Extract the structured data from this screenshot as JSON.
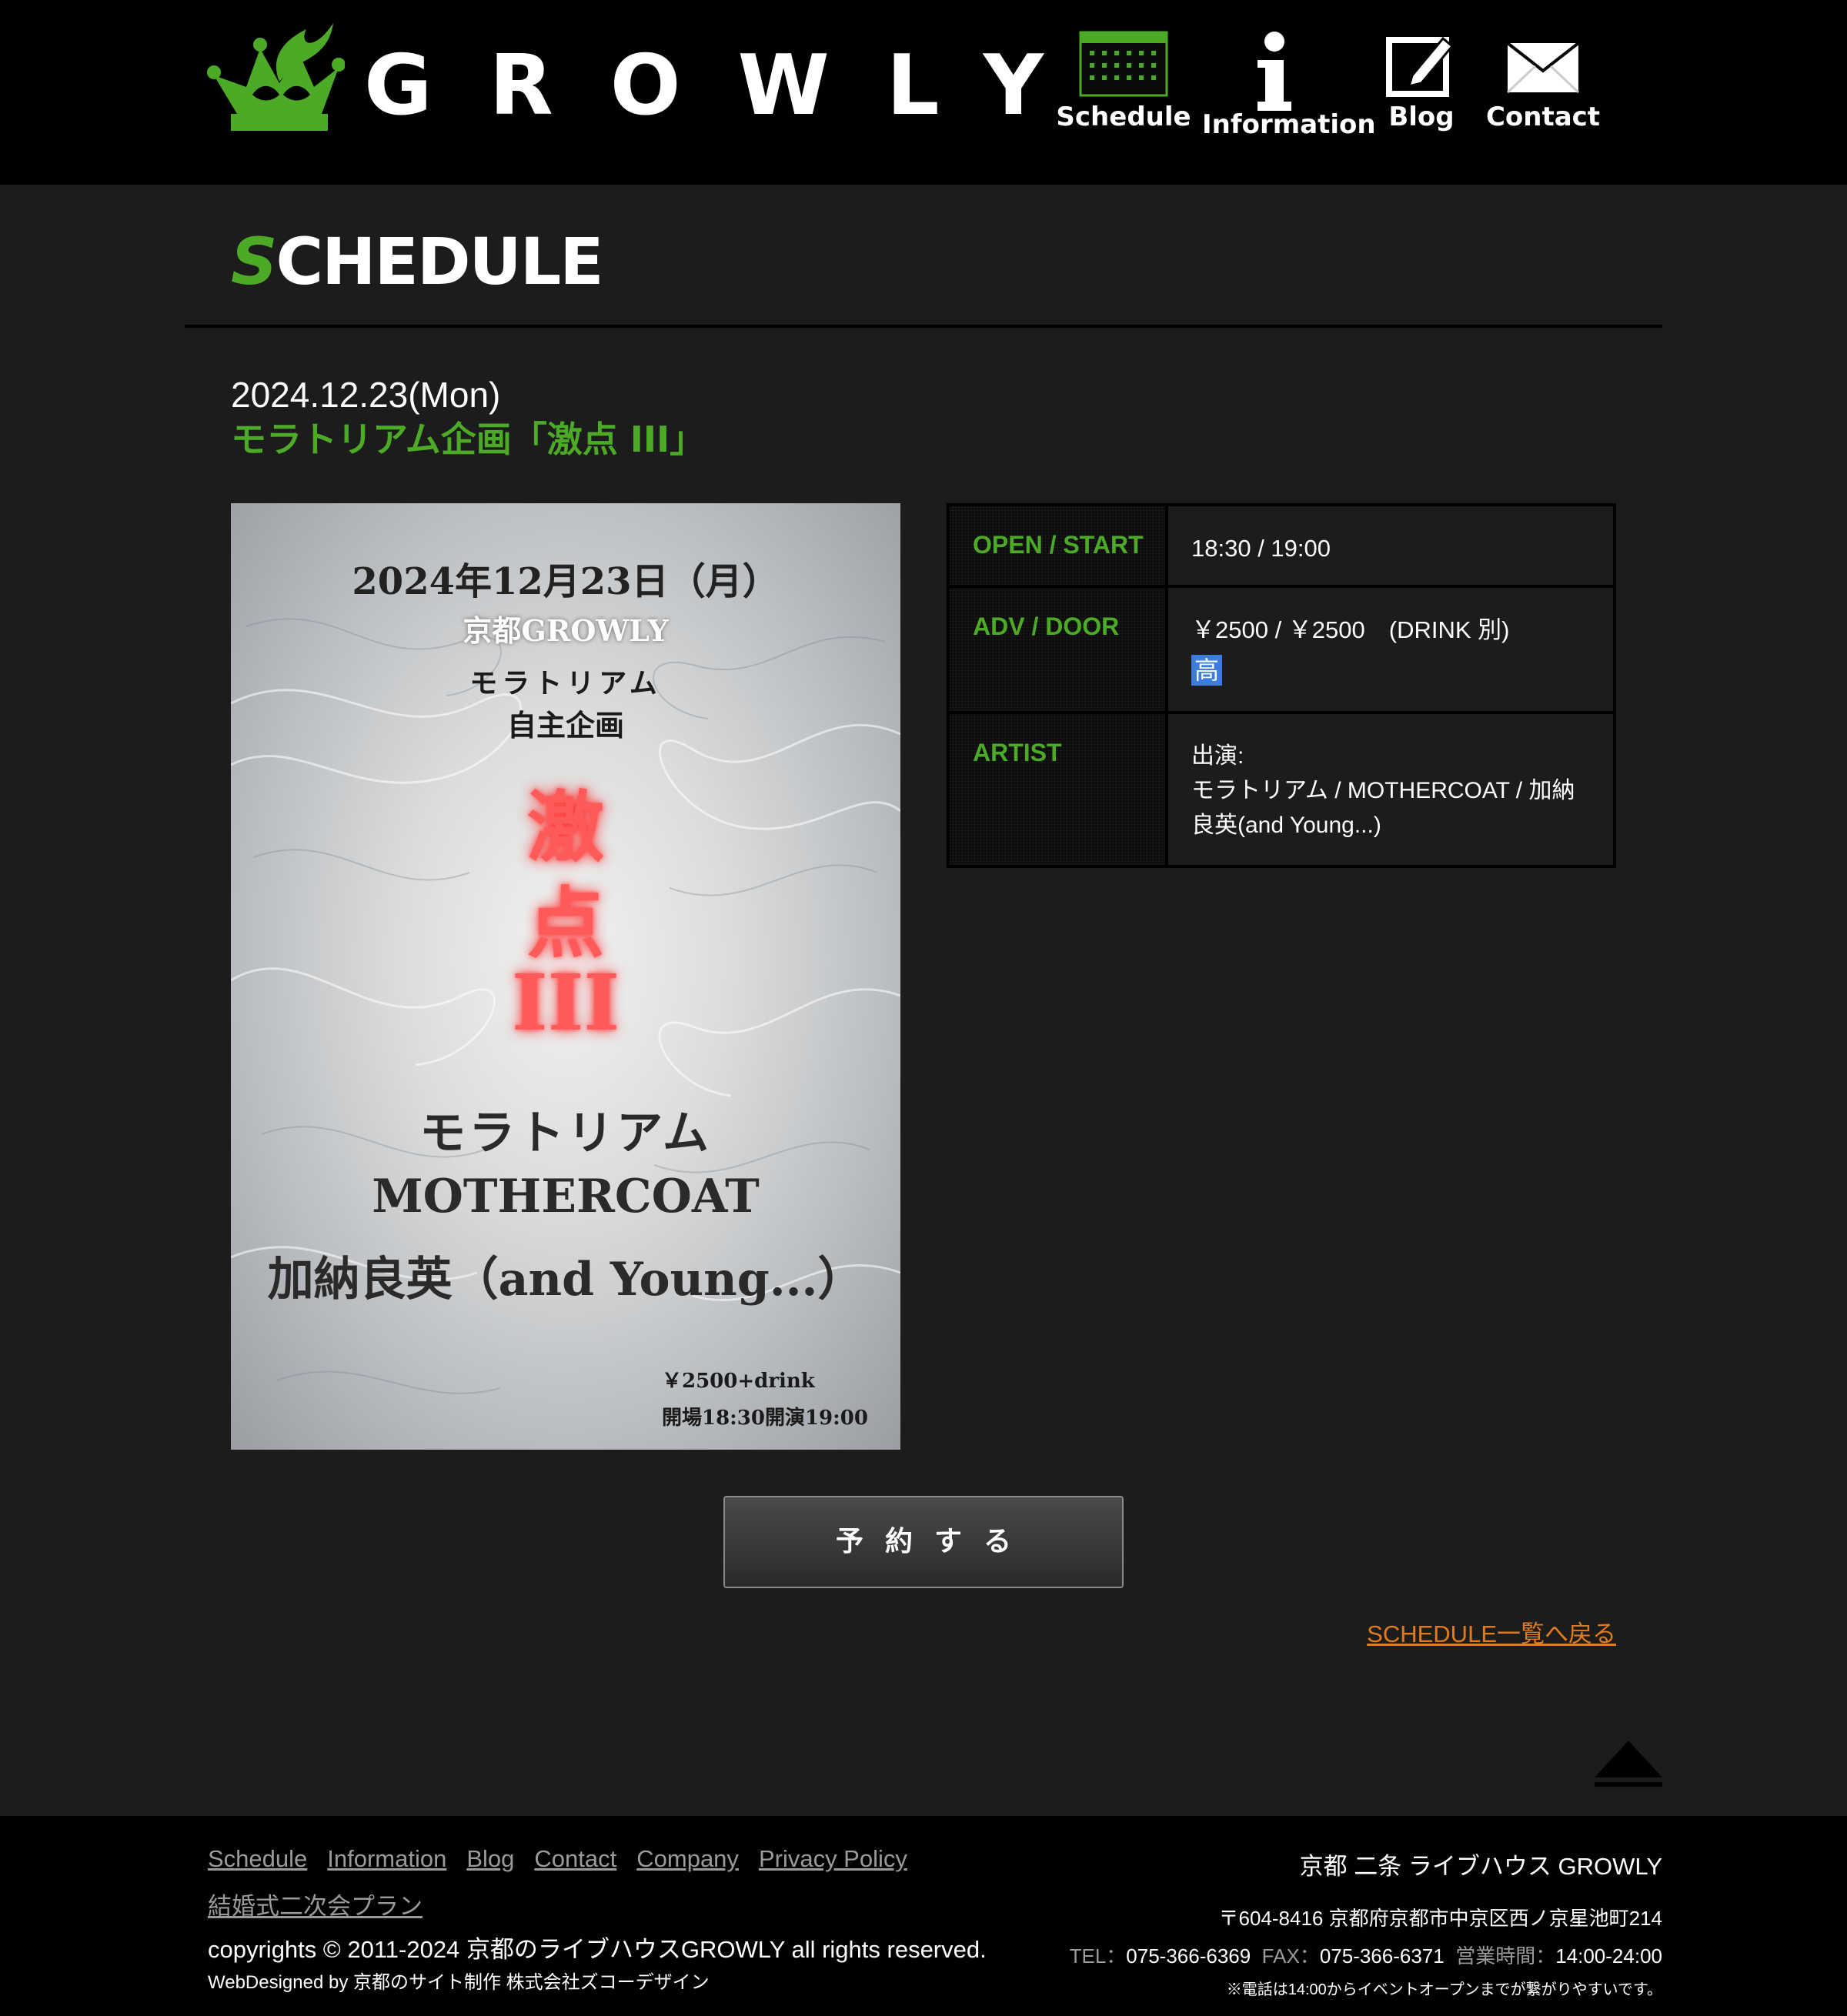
{
  "header": {
    "logo_text": "GROWLY",
    "nav": [
      {
        "label": "Schedule",
        "icon": "calendar-icon"
      },
      {
        "label": "Information",
        "icon": "info-icon"
      },
      {
        "label": "Blog",
        "icon": "pencil-note-icon"
      },
      {
        "label": "Contact",
        "icon": "envelope-icon"
      }
    ]
  },
  "page": {
    "heading": "SCHEDULE",
    "heading_first": "S",
    "heading_rest": "CHEDULE"
  },
  "event": {
    "date": "2024.12.23(Mon)",
    "title": "モラトリアム企画「激点 III」",
    "flyer": {
      "date": "2024年12月23日（月）",
      "venue": "京都GROWLY",
      "org_line1": "モラトリアム",
      "org_line2": "自主企画",
      "big1": "激",
      "big2": "点",
      "big3": "III",
      "artist1": "モラトリアム",
      "artist2": "MOTHERCOAT",
      "artist3": "加納良英（and Young...）",
      "price": "￥2500+drink",
      "time": "開場18:30開演19:00"
    },
    "info": {
      "open_label": "OPEN / START",
      "open_value": "18:30 / 19:00",
      "adv_label": "ADV / DOOR",
      "adv_value": "￥2500 / ￥2500　(DRINK 別)",
      "adv_badge": "高",
      "artist_label": "ARTIST",
      "artist_prefix": "出演:",
      "artist_line1": "モラトリアム / MOTHERCOAT / 加納",
      "artist_line2": "良英(and Young...)"
    },
    "reserve_label": "予約する",
    "back_link": "SCHEDULE一覧へ戻る"
  },
  "footer": {
    "links": [
      "Schedule",
      "Information",
      "Blog",
      "Contact",
      "Company",
      "Privacy Policy",
      "結婚式二次会プラン"
    ],
    "copyright": "copyrights © 2011-2024 京都のライブハウスGROWLY all rights reserved.",
    "webdesign": "WebDesigned by 京都のサイト制作 株式会社ズコーデザイン",
    "venue_name": "京都 二条 ライブハウス GROWLY",
    "address": "〒604-8416 京都府京都市中京区西ノ京星池町214",
    "tel_label": "TEL：",
    "tel": "075-366-6369",
    "fax_label": "FAX：",
    "fax": "075-366-6371",
    "hours_label": "営業時間：",
    "hours": "14:00-24:00",
    "note": "※電話は14:00からイベントオープンまでが繋がりやすいです。"
  },
  "colors": {
    "accent_green": "#4caa27",
    "link_orange": "#e07c1c",
    "badge_blue": "#3d7de0"
  }
}
